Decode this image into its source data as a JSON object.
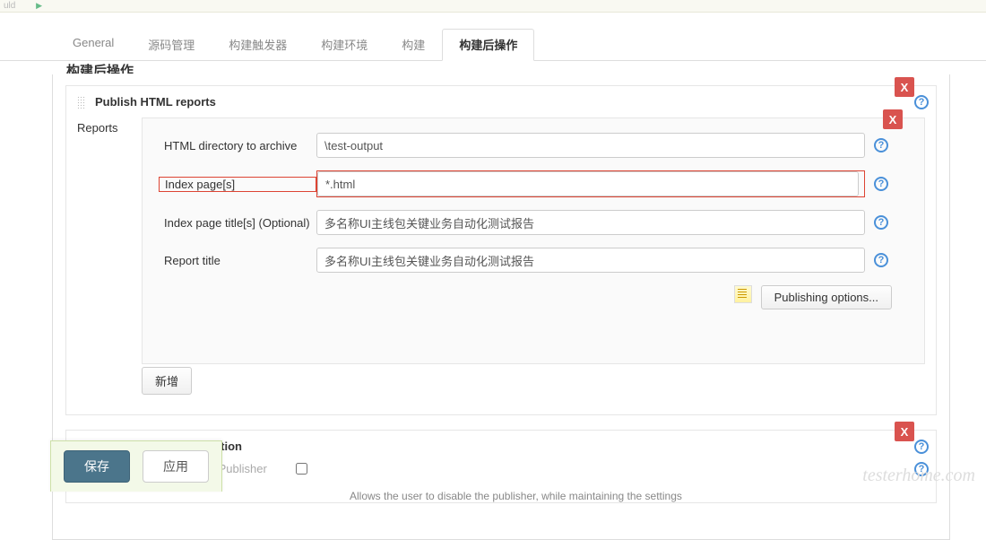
{
  "topbar": {
    "crumb": "uld"
  },
  "tabs": [
    {
      "label": "General"
    },
    {
      "label": "源码管理"
    },
    {
      "label": "构建触发器"
    },
    {
      "label": "构建环境"
    },
    {
      "label": "构建"
    },
    {
      "label": "构建后操作"
    }
  ],
  "section_cut": "构建后操作",
  "block1": {
    "title": "Publish HTML reports",
    "close": "X",
    "reports_label": "Reports",
    "rows": {
      "dir": {
        "label": "HTML directory to archive",
        "value": "\\test-output"
      },
      "index": {
        "label": "Index page[s]",
        "value": "*.html"
      },
      "titles": {
        "label": "Index page title[s] (Optional)",
        "value": "多名称UI主线包关键业务自动化测试报告"
      },
      "report": {
        "label": "Report title",
        "value": "多名称UI主线包关键业务自动化测试报告"
      }
    },
    "publishing_btn": "Publishing options...",
    "add_btn": "新增"
  },
  "block2": {
    "title": "Editable Email Notification",
    "close": "X",
    "disable_label": "Disable Extended Email Publisher",
    "desc": "Allows the user to disable the publisher, while maintaining the settings"
  },
  "footer": {
    "save": "保存",
    "apply": "应用"
  },
  "watermark": "testerhome.com",
  "help_glyph": "?"
}
